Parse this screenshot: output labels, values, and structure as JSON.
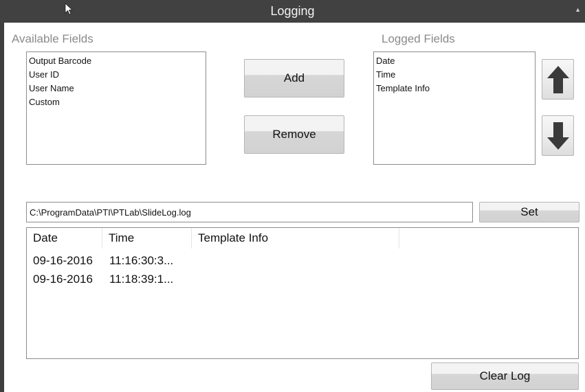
{
  "window": {
    "title": "Logging"
  },
  "available": {
    "label": "Available Fields",
    "items": [
      "Output Barcode",
      "User ID",
      "User Name",
      "Custom"
    ]
  },
  "logged": {
    "label": "Logged Fields",
    "items": [
      "Date",
      "Time",
      "Template Info"
    ]
  },
  "buttons": {
    "add": "Add",
    "remove": "Remove",
    "set": "Set",
    "clear_log": "Clear Log"
  },
  "log_path": {
    "value": "C:\\ProgramData\\PTI\\PTLab\\SlideLog.log"
  },
  "log_table": {
    "columns": [
      "Date",
      "Time",
      "Template Info"
    ],
    "rows": [
      [
        "09-16-2016",
        "11:16:30:3...",
        ""
      ],
      [
        "09-16-2016",
        "11:18:39:1...",
        ""
      ]
    ]
  }
}
